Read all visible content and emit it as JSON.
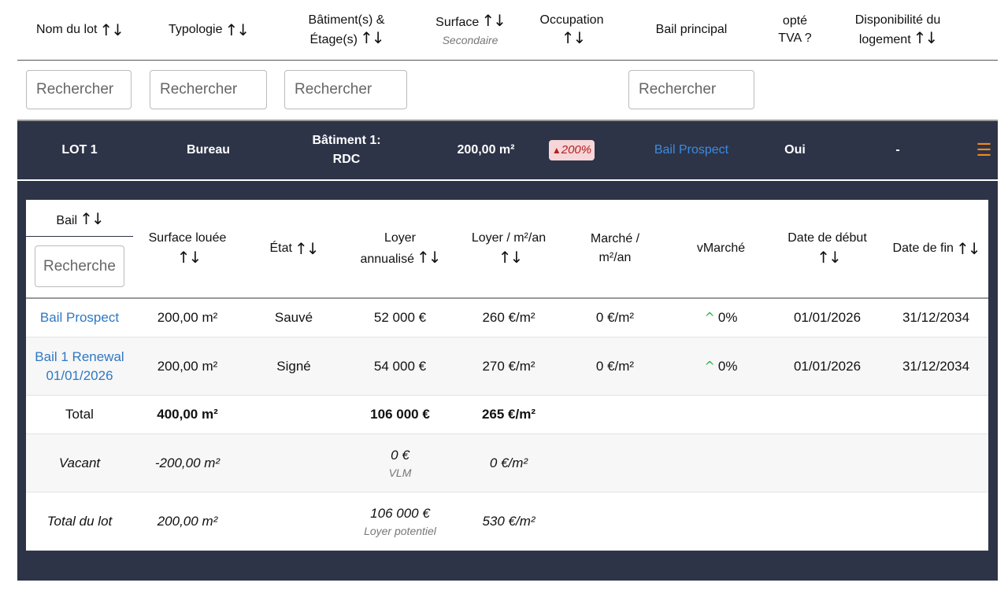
{
  "header": {
    "nom_du_lot": "Nom du lot",
    "typologie": "Typologie",
    "batiments_l1": "Bâtiment(s) &",
    "batiments_l2": "Étage(s)",
    "surface": "Surface",
    "surface_sub": "Secondaire",
    "occupation": "Occupation",
    "bail_principal": "Bail principal",
    "tva_l1": "opté",
    "tva_l2": "TVA ?",
    "dispo_l1": "Disponibilité du",
    "dispo_l2": "logement",
    "sort_icon": "↑↓"
  },
  "filters": {
    "placeholder": "Rechercher"
  },
  "lot": {
    "name": "LOT 1",
    "typologie": "Bureau",
    "batiment_l1": "Bâtiment 1:",
    "batiment_l2": "RDC",
    "surface": "200,00 m²",
    "occupation_badge": "200%",
    "warning_icon": "▲",
    "bail_principal": "Bail Prospect",
    "tva": "Oui",
    "disponibilite": "-",
    "menu_icon": "☰"
  },
  "subheader": {
    "bail": "Bail",
    "surface_louee": "Surface louée",
    "etat": "État",
    "loyer_l1": "Loyer",
    "loyer_l2": "annualisé",
    "loyer_m2_l1": "Loyer / m²/an",
    "marche_l1": "Marché /",
    "marche_l2": "m²/an",
    "vmarche": "vMarché",
    "date_debut": "Date de début",
    "date_fin": "Date de fin",
    "search_placeholder": "Rechercher"
  },
  "baux": [
    {
      "bail": "Bail Prospect",
      "surface": "200,00 m²",
      "etat": "Sauvé",
      "loyer": "52 000 €",
      "loyer_m2": "260 €/m²",
      "marche": "0 €/m²",
      "vmarche": "0%",
      "debut": "01/01/2026",
      "fin": "31/12/2034"
    },
    {
      "bail_l1": "Bail 1 Renewal",
      "bail_l2": "01/01/2026",
      "surface": "200,00 m²",
      "etat": "Signé",
      "loyer": "54 000 €",
      "loyer_m2": "270 €/m²",
      "marche": "0 €/m²",
      "vmarche": "0%",
      "debut": "01/01/2026",
      "fin": "31/12/2034"
    }
  ],
  "total": {
    "label": "Total",
    "surface": "400,00 m²",
    "loyer": "106 000 €",
    "loyer_m2": "265 €/m²"
  },
  "vacant": {
    "label": "Vacant",
    "surface": "-200,00 m²",
    "loyer": "0 €",
    "loyer_note": "VLM",
    "loyer_m2": "0 €/m²"
  },
  "total_lot": {
    "label": "Total du lot",
    "surface": "200,00 m²",
    "loyer": "106 000 €",
    "loyer_note": "Loyer potentiel",
    "loyer_m2": "530 €/m²"
  },
  "colors": {
    "dark_bg": "#2d3448",
    "accent_orange": "#f28a1c",
    "link_blue": "#2f78c4",
    "positive_green": "#2fb34b",
    "badge_red": "#b3201f"
  }
}
